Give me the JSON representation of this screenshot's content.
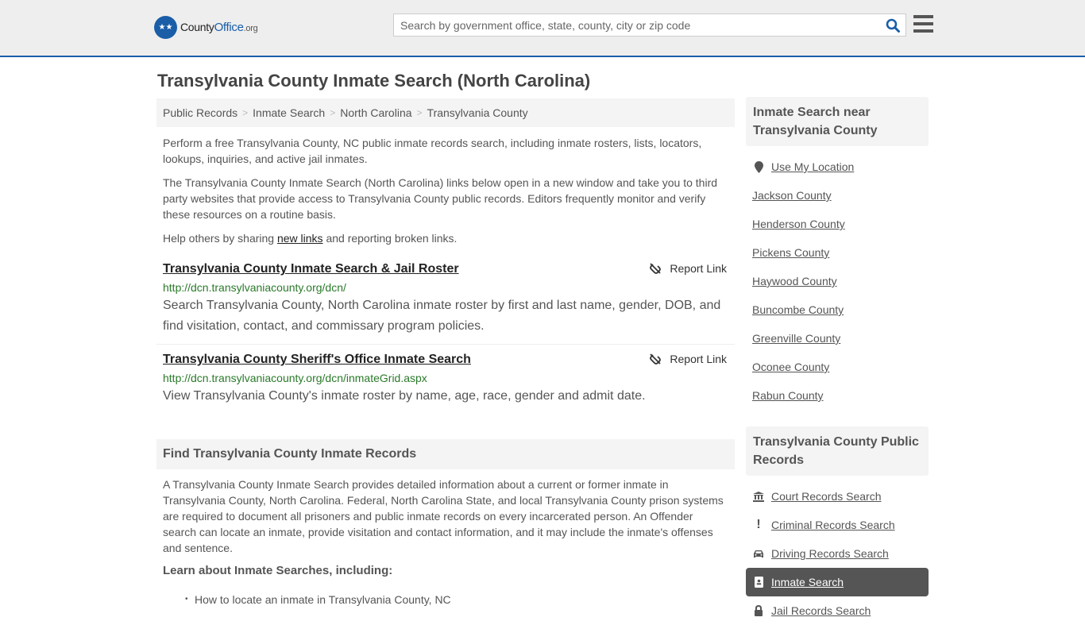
{
  "header": {
    "logo_main": "County",
    "logo_brand": "Office",
    "logo_tld": ".org",
    "search_placeholder": "Search by government office, state, county, city or zip code"
  },
  "page_title": "Transylvania County Inmate Search (North Carolina)",
  "breadcrumb": [
    "Public Records",
    "Inmate Search",
    "North Carolina",
    "Transylvania County"
  ],
  "intro": {
    "p1": "Perform a free Transylvania County, NC public inmate records search, including inmate rosters, lists, locators, lookups, inquiries, and active jail inmates.",
    "p2": "The Transylvania County Inmate Search (North Carolina) links below open in a new window and take you to third party websites that provide access to Transylvania County public records. Editors frequently monitor and verify these resources on a routine basis.",
    "p3_before": "Help others by sharing ",
    "p3_link": "new links",
    "p3_after": " and reporting broken links."
  },
  "links": [
    {
      "title": "Transylvania County Inmate Search & Jail Roster",
      "url": "http://dcn.transylvaniacounty.org/dcn/",
      "description": "Search Transylvania County, North Carolina inmate roster by first and last name, gender, DOB, and find visitation, contact, and commissary program policies.",
      "report_label": "Report Link"
    },
    {
      "title": "Transylvania County Sheriff's Office Inmate Search",
      "url": "http://dcn.transylvaniacounty.org/dcn/inmateGrid.aspx",
      "description": "View Transylvania County's inmate roster by name, age, race, gender and admit date.",
      "report_label": "Report Link"
    }
  ],
  "find_section": {
    "heading": "Find Transylvania County Inmate Records",
    "body": "A Transylvania County Inmate Search provides detailed information about a current or former inmate in Transylvania County, North Carolina. Federal, North Carolina State, and local Transylvania County prison systems are required to document all prisoners and public inmate records on every incarcerated person. An Offender search can locate an inmate, provide visitation and contact information, and it may include the inmate's offenses and sentence.",
    "subheading": "Learn about Inmate Searches, including:",
    "bullets": [
      "How to locate an inmate in Transylvania County, NC"
    ]
  },
  "sidebar": {
    "near_heading": "Inmate Search near Transylvania County",
    "use_location": "Use My Location",
    "near_items": [
      "Jackson County",
      "Henderson County",
      "Pickens County",
      "Haywood County",
      "Buncombe County",
      "Greenville County",
      "Oconee County",
      "Rabun County"
    ],
    "records_heading": "Transylvania County Public Records",
    "records_items": [
      {
        "label": "Court Records Search",
        "icon": "courthouse-icon"
      },
      {
        "label": "Criminal Records Search",
        "icon": "exclamation-icon"
      },
      {
        "label": "Driving Records Search",
        "icon": "car-icon"
      },
      {
        "label": "Inmate Search",
        "icon": "id-badge-icon",
        "active": true
      },
      {
        "label": "Jail Records Search",
        "icon": "lock-icon"
      }
    ]
  }
}
